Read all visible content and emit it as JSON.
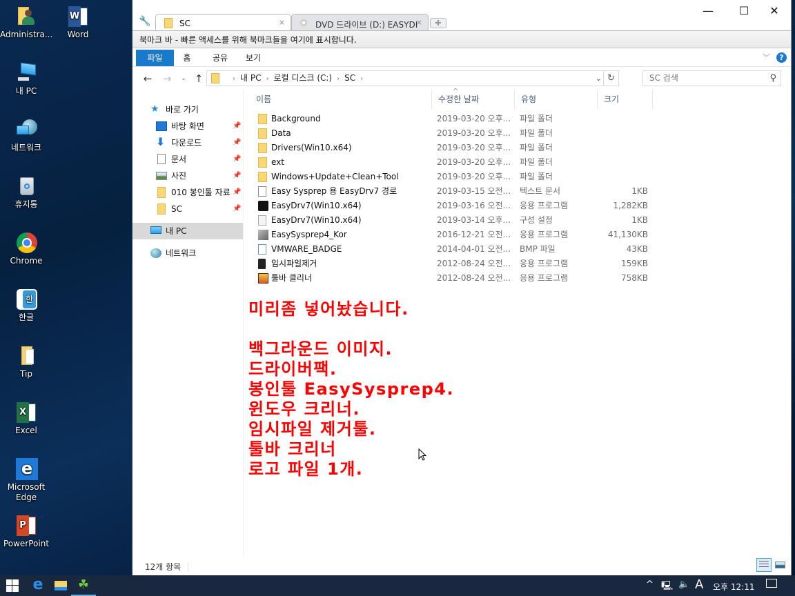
{
  "desktop": {
    "icons": [
      {
        "label": "Administra...",
        "icon": "user-folder-icon"
      },
      {
        "label": "Word",
        "icon": "word-icon"
      },
      {
        "label": "내 PC",
        "icon": "computer-icon"
      },
      {
        "label": "네트워크",
        "icon": "network-icon"
      },
      {
        "label": "휴지통",
        "icon": "recycle-bin-icon"
      },
      {
        "label": "Chrome",
        "icon": "chrome-icon"
      },
      {
        "label": "한글",
        "icon": "hangul-icon"
      },
      {
        "label": "Tip",
        "icon": "folder-icon"
      },
      {
        "label": "Excel",
        "icon": "excel-icon"
      },
      {
        "label": "Microsoft Edge",
        "icon": "edge-icon"
      },
      {
        "label": "PowerPoint",
        "icon": "powerpoint-icon"
      }
    ]
  },
  "window": {
    "tabs": [
      {
        "label": "SC",
        "close": "×",
        "active": true
      },
      {
        "label": "DVD 드라이브 (D:) EASYDI",
        "close": "×",
        "active": false
      }
    ],
    "controls": {
      "minimize": "—",
      "maximize": "☐",
      "close": "✕"
    },
    "bookmark_bar": "북마크 바 - 빠른 액세스를 위해 북마크들을 여기에 표시합니다.",
    "ribbon": {
      "tabs": [
        "파일",
        "홈",
        "공유",
        "보기"
      ],
      "help": "?"
    },
    "address": {
      "crumbs": [
        "내 PC",
        "로컬 디스크 (C:)",
        "SC"
      ]
    },
    "search": {
      "placeholder": "SC 검색"
    },
    "navpane": {
      "quick_access": "바로 가기",
      "items": [
        {
          "label": "바탕 화면",
          "pinned": true
        },
        {
          "label": "다운로드",
          "pinned": true
        },
        {
          "label": "문서",
          "pinned": true
        },
        {
          "label": "사진",
          "pinned": true
        },
        {
          "label": "010 봉인툴 자료",
          "pinned": true
        },
        {
          "label": "SC",
          "pinned": true
        }
      ],
      "this_pc": "내 PC",
      "network": "네트워크"
    },
    "columns": [
      "이름",
      "수정한 날짜",
      "유형",
      "크기"
    ],
    "files": [
      {
        "name": "Background",
        "date": "2019-03-20 오후...",
        "type": "파일 폴더",
        "size": "",
        "icon": "folder"
      },
      {
        "name": "Data",
        "date": "2019-03-20 오후...",
        "type": "파일 폴더",
        "size": "",
        "icon": "folder"
      },
      {
        "name": "Drivers(Win10.x64)",
        "date": "2019-03-20 오후...",
        "type": "파일 폴더",
        "size": "",
        "icon": "folder"
      },
      {
        "name": "ext",
        "date": "2019-03-20 오후...",
        "type": "파일 폴더",
        "size": "",
        "icon": "folder"
      },
      {
        "name": "Windows+Update+Clean+Tool",
        "date": "2019-03-20 오후...",
        "type": "파일 폴더",
        "size": "",
        "icon": "folder"
      },
      {
        "name": "Easy Sysprep 용 EasyDrv7 경로",
        "date": "2019-03-15 오전...",
        "type": "텍스트 문서",
        "size": "1KB",
        "icon": "text"
      },
      {
        "name": "EasyDrv7(Win10.x64)",
        "date": "2019-03-16 오전...",
        "type": "응용 프로그램",
        "size": "1,282KB",
        "icon": "app-black"
      },
      {
        "name": "EasyDrv7(Win10.x64)",
        "date": "2019-03-14 오후...",
        "type": "구성 설정",
        "size": "1KB",
        "icon": "config"
      },
      {
        "name": "EasySysprep4_Kor",
        "date": "2016-12-21 오전...",
        "type": "응용 프로그램",
        "size": "41,130KB",
        "icon": "app-gray"
      },
      {
        "name": "VMWARE_BADGE",
        "date": "2014-04-01 오전...",
        "type": "BMP 파일",
        "size": "43KB",
        "icon": "bmp"
      },
      {
        "name": "임시파일제거",
        "date": "2012-08-24 오전...",
        "type": "응용 프로그램",
        "size": "159KB",
        "icon": "trash"
      },
      {
        "name": "툴바 클리너",
        "date": "2012-08-24 오전...",
        "type": "응용 프로그램",
        "size": "758KB",
        "icon": "toolbar-cleaner"
      }
    ],
    "note": "미리좀 넣어놨습니다.\n\n백그라운드 이미지.\n드라이버팩.\n봉인툴 EasySysprep4.\n윈도우 크리너.\n임시파일 제거툴.\n툴바 크리너\n로고 파일 1개.",
    "status": {
      "count": "12개 항목"
    }
  },
  "taskbar": {
    "clock": "오후 12:11",
    "ime": "A",
    "tray_chevron": "^"
  },
  "colors": {
    "accent": "#1979ca",
    "note": "#ff0000",
    "taskbar": "#19283d"
  }
}
